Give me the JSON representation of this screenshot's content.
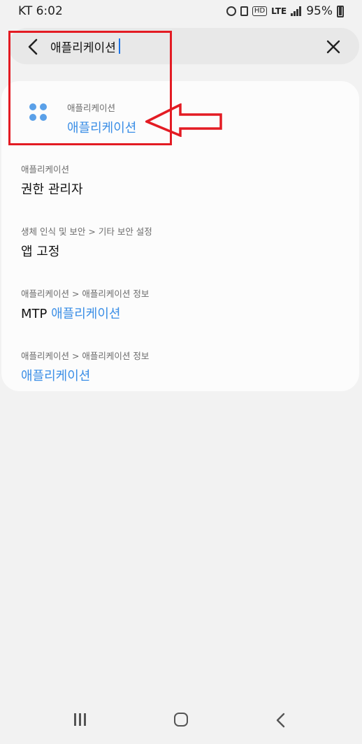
{
  "status_bar": {
    "carrier_time": "KT 6:02",
    "network": "LTE",
    "battery": "95%"
  },
  "search": {
    "query": "애플리케이션",
    "back_icon": "chevron-left-icon",
    "clear_icon": "close-icon"
  },
  "results": [
    {
      "path": "애플리케이션",
      "title_prefix": "",
      "title_highlight": "애플리케이션",
      "title_suffix": "",
      "icon": "apps-grid-icon"
    },
    {
      "path": "애플리케이션",
      "title_prefix": "권한 관리자",
      "title_highlight": "",
      "title_suffix": ""
    },
    {
      "path": "생체 인식 및 보안 > 기타 보안 설정",
      "title_prefix": "앱 고정",
      "title_highlight": "",
      "title_suffix": ""
    },
    {
      "path": "애플리케이션 > 애플리케이션 정보",
      "title_prefix": "MTP ",
      "title_highlight": "애플리케이션",
      "title_suffix": ""
    },
    {
      "path": "애플리케이션 > 애플리케이션 정보",
      "title_prefix": "",
      "title_highlight": "애플리케이션",
      "title_suffix": ""
    }
  ],
  "colors": {
    "highlight": "#3a8ee6",
    "annotation": "#e31b23",
    "icon": "#5aa0e8"
  },
  "nav_bar": {
    "recents_icon": "recents-icon",
    "home_icon": "home-icon",
    "back_icon": "back-icon"
  }
}
